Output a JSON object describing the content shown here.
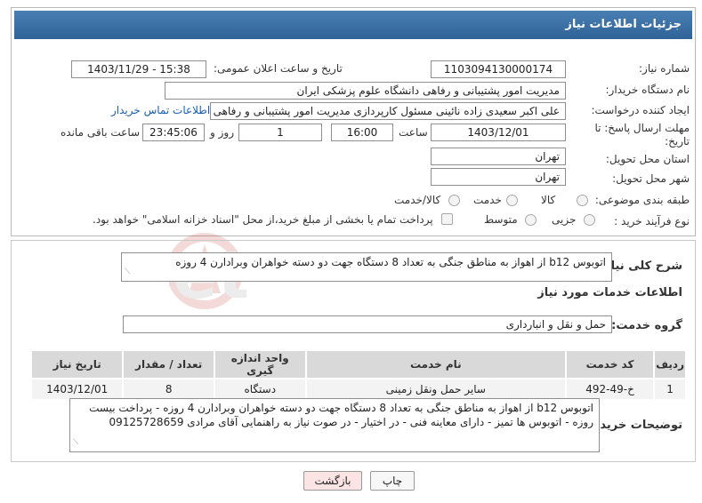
{
  "header": {
    "title": "جزئیات اطلاعات نیاز"
  },
  "fields": {
    "need_number_label": "شماره نیاز:",
    "need_number": "1103094130000174",
    "announce_label": "تاریخ و ساعت اعلان عمومی:",
    "announce_value": "1403/11/29 - 15:38",
    "buyer_label": "نام دستگاه خریدار:",
    "buyer_value": "مدیریت امور پشتیبانی و رفاهی دانشگاه علوم پزشکی ایران",
    "creator_label": "ایجاد کننده درخواست:",
    "creator_value": "علی اکبر سعیدی زاده نائینی مسئول کارپردازی مدیریت امور پشتیبانی و رفاهی",
    "contact_link": "اطلاعات تماس خریدار",
    "deadline_label_1": "مهلت ارسال پاسخ: تا",
    "deadline_label_2": "تاریخ:",
    "deadline_date": "1403/12/01",
    "time_label": "ساعت",
    "deadline_time": "16:00",
    "days_value": "1",
    "days_label": "روز و",
    "remaining_time": "23:45:06",
    "remaining_label": "ساعت باقی مانده",
    "province_label": "استان محل تحویل:",
    "province_value": "تهران",
    "city_label": "شهر محل تحویل:",
    "city_value": "تهران",
    "category_label": "طبقه بندی موضوعی:",
    "category_options": [
      "کالا",
      "خدمت",
      "کالا/خدمت"
    ],
    "process_label": "نوع فرآیند خرید :",
    "process_options": [
      "جزیی",
      "متوسط"
    ],
    "payment_note": "پرداخت تمام یا بخشی از مبلغ خرید،از محل \"اسناد خزانه اسلامی\" خواهد بود."
  },
  "summary": {
    "label": "شرح کلی نیاز:",
    "text": "اتوبوس b12  از اهواز به مناطق جنگی به تعداد 8 دستگاه جهت دو دسته خواهران وبرادارن 4 روزه"
  },
  "services": {
    "section_title": "اطلاعات خدمات مورد نیاز",
    "group_label": "گروه خدمت:",
    "group_value": "حمل و نقل و انبارداری",
    "columns": [
      "ردیف",
      "کد خدمت",
      "نام خدمت",
      "واحد اندازه گیری",
      "تعداد / مقدار",
      "تاریخ نیاز"
    ],
    "rows": [
      [
        "1",
        "خ-49-492",
        "سایر حمل ونقل زمینی",
        "دستگاه",
        "8",
        "1403/12/01"
      ]
    ]
  },
  "buyer_notes": {
    "label": "توضیحات خریدار:",
    "text": "اتوبوس b12  از اهواز به مناطق جنگی به تعداد 8 دستگاه جهت دو دسته خواهران وبرادارن 4 روزه - پرداخت بیست روزه - اتوبوس ها تمیز - دارای معاینه فنی - در اختیار - در صوت نیاز به راهنمایی آقای مرادی 09125728659"
  },
  "buttons": {
    "print": "چاپ",
    "back": "بازگشت"
  },
  "watermark": "AriaTender.net",
  "colors": {
    "header": "#2f6397",
    "back_button": "#fde4e4",
    "link": "#1a5fb4"
  }
}
